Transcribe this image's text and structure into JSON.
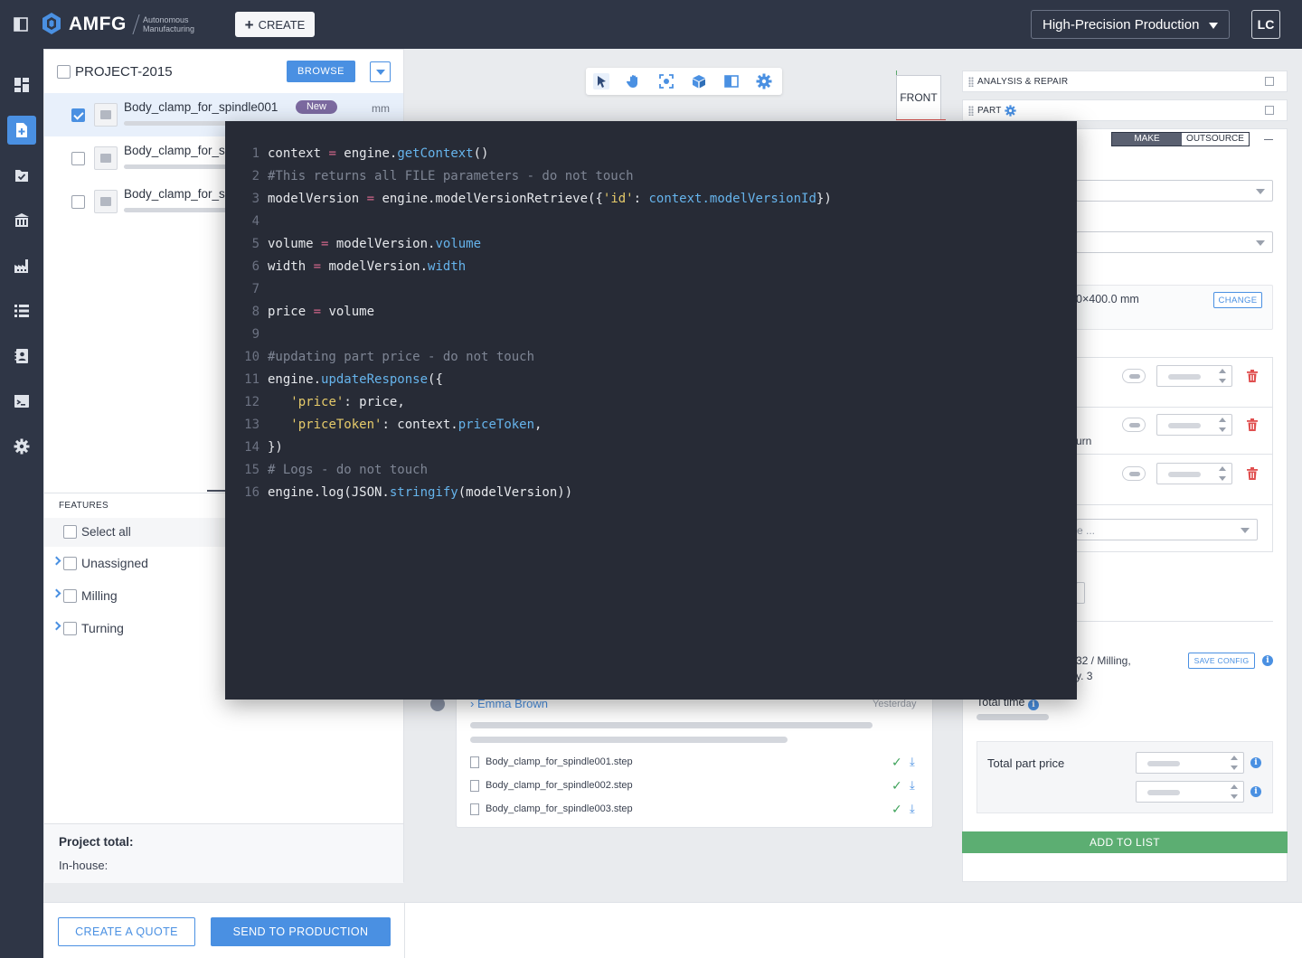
{
  "app": {
    "logo_text": "AMFG",
    "tagline_line1": "Autonomous",
    "tagline_line2": "Manufacturing",
    "create_label": "CREATE",
    "production_mode": "High-Precision Production",
    "user_initials": "LC"
  },
  "sidebar": {
    "items": [
      {
        "name": "dashboard",
        "icon": "dashboard-icon",
        "active": false
      },
      {
        "name": "new-project",
        "icon": "add-document-icon",
        "active": true
      },
      {
        "name": "orders",
        "icon": "checklist-icon",
        "active": false
      },
      {
        "name": "institutions",
        "icon": "building-icon",
        "active": false
      },
      {
        "name": "factory",
        "icon": "factory-icon",
        "active": false
      },
      {
        "name": "lists",
        "icon": "list-icon",
        "active": false
      },
      {
        "name": "contacts",
        "icon": "contacts-icon",
        "active": false
      },
      {
        "name": "scripts",
        "icon": "terminal-icon",
        "active": false
      },
      {
        "name": "settings",
        "icon": "gear-icon",
        "active": false
      }
    ]
  },
  "project": {
    "title": "PROJECT-2015",
    "browse_label": "BROWSE",
    "files": [
      {
        "name": "Body_clamp_for_spindle001",
        "badge": "New",
        "unit": "mm",
        "checked": true
      },
      {
        "name": "Body_clamp_for_sp",
        "checked": false
      },
      {
        "name": "Body_clamp_for_sp",
        "checked": false
      }
    ],
    "features_label": "FEATURES",
    "select_all_label": "Select all",
    "feature_groups": [
      "Unassigned",
      "Milling",
      "Turning"
    ],
    "total_label": "Project total:",
    "inhouse_label": "In-house:"
  },
  "viewer": {
    "view_cube_label": "FRONT"
  },
  "comment": {
    "author": "Emma Brown",
    "time": "Yesterday",
    "attachments": [
      "Body_clamp_for_spindle001.step",
      "Body_clamp_for_spindle002.step",
      "Body_clamp_for_spindle003.step"
    ]
  },
  "right": {
    "analysis_label": "ANALYSIS & REPAIR",
    "part_label": "PART",
    "make_label": "MAKE",
    "outsource_label": "OUTSOURCE",
    "dims_text": "0×400.0 mm",
    "change_label": "CHANGE",
    "op_partial_text": "urn",
    "select_partial": "e ...",
    "config_line1": "32 / Milling,",
    "config_line2": "y. 3",
    "save_config_label": "SAVE CONFIG",
    "total_time_label": "Total time",
    "total_part_price_label": "Total part price",
    "add_to_list_label": "ADD TO LIST"
  },
  "bottom": {
    "create_quote_label": "CREATE A QUOTE",
    "send_to_production_label": "SEND TO PRODUCTION"
  },
  "code": {
    "lines": [
      {
        "n": "1",
        "tokens": [
          [
            "",
            "context "
          ],
          [
            "op",
            "="
          ],
          [
            "",
            " engine."
          ],
          [
            "fn",
            "getContext"
          ],
          [
            "",
            "()"
          ]
        ]
      },
      {
        "n": "2",
        "tokens": [
          [
            "cm",
            "#This returns all FILE parameters - do not touch"
          ]
        ]
      },
      {
        "n": "3",
        "tokens": [
          [
            "",
            "modelVersion "
          ],
          [
            "op",
            "="
          ],
          [
            "",
            " engine.modelVersionRetrieve({"
          ],
          [
            "str",
            "'id'"
          ],
          [
            "",
            ": "
          ],
          [
            "prop",
            "context.modelVersionId"
          ],
          [
            "",
            "})"
          ]
        ]
      },
      {
        "n": "4",
        "tokens": []
      },
      {
        "n": "5",
        "tokens": [
          [
            "",
            "volume "
          ],
          [
            "op",
            "="
          ],
          [
            "",
            " modelVersion."
          ],
          [
            "prop",
            "volume"
          ]
        ]
      },
      {
        "n": "6",
        "tokens": [
          [
            "",
            "width "
          ],
          [
            "op",
            "="
          ],
          [
            "",
            " modelVersion."
          ],
          [
            "prop",
            "width"
          ]
        ]
      },
      {
        "n": "7",
        "tokens": []
      },
      {
        "n": "8",
        "tokens": [
          [
            "",
            "price "
          ],
          [
            "op",
            "="
          ],
          [
            "",
            " volume"
          ]
        ]
      },
      {
        "n": "9",
        "tokens": []
      },
      {
        "n": "10",
        "tokens": [
          [
            "cm",
            "#updating part price - do not touch"
          ]
        ]
      },
      {
        "n": "11",
        "tokens": [
          [
            "",
            "engine."
          ],
          [
            "fn",
            "updateResponse"
          ],
          [
            "",
            "({"
          ]
        ]
      },
      {
        "n": "12",
        "tokens": [
          [
            "",
            "   "
          ],
          [
            "str",
            "'price'"
          ],
          [
            "",
            ": price,"
          ]
        ]
      },
      {
        "n": "13",
        "tokens": [
          [
            "",
            "   "
          ],
          [
            "str",
            "'priceToken'"
          ],
          [
            "",
            ": context."
          ],
          [
            "prop",
            "priceToken"
          ],
          [
            "",
            ","
          ]
        ]
      },
      {
        "n": "14",
        "tokens": [
          [
            "",
            "})"
          ]
        ]
      },
      {
        "n": "15",
        "tokens": [
          [
            "cm",
            "# Logs - do not touch"
          ]
        ]
      },
      {
        "n": "16",
        "tokens": [
          [
            "",
            "engine.log(JSON."
          ],
          [
            "fn",
            "stringify"
          ],
          [
            "",
            "(modelVersion))"
          ]
        ]
      }
    ]
  }
}
